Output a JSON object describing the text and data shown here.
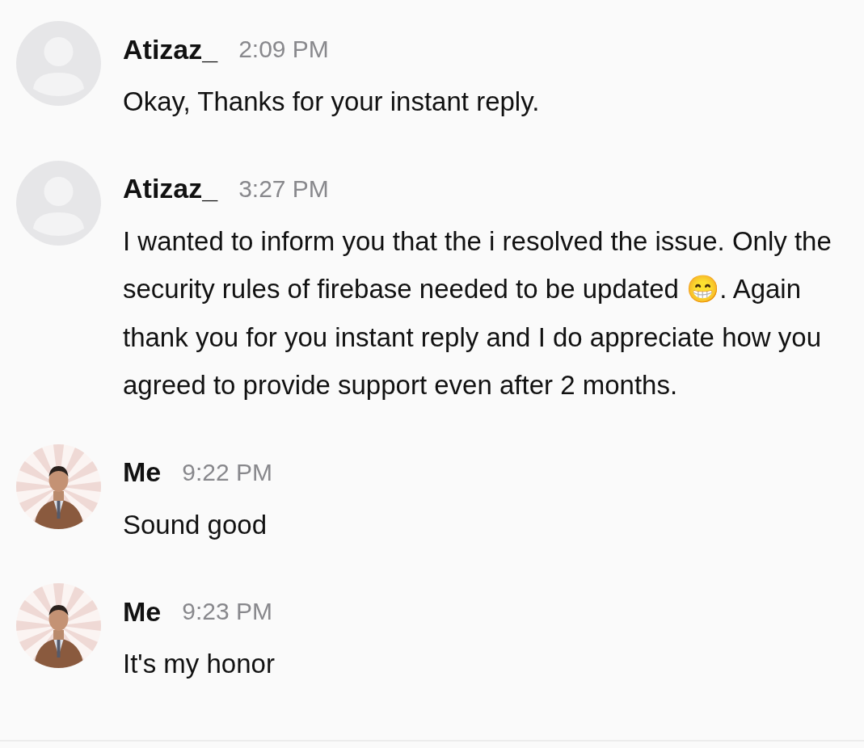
{
  "messages": [
    {
      "avatar": {
        "kind": "default"
      },
      "sender": "Atizaz_",
      "time": "2:09 PM",
      "text": "Okay, Thanks for your instant reply."
    },
    {
      "avatar": {
        "kind": "default"
      },
      "sender": "Atizaz_",
      "time": "3:27 PM",
      "text": "I wanted to inform you that the i resolved the issue. Only the security rules of firebase needed to be updated 😁. Again thank you for you instant reply and I do appreciate how you agreed to provide support even after 2 months."
    },
    {
      "sender": "Me",
      "time": "9:22 PM",
      "text": "Sound good"
    },
    {
      "sender": "Me",
      "time": "9:23 PM",
      "text": "It's my honor"
    }
  ]
}
